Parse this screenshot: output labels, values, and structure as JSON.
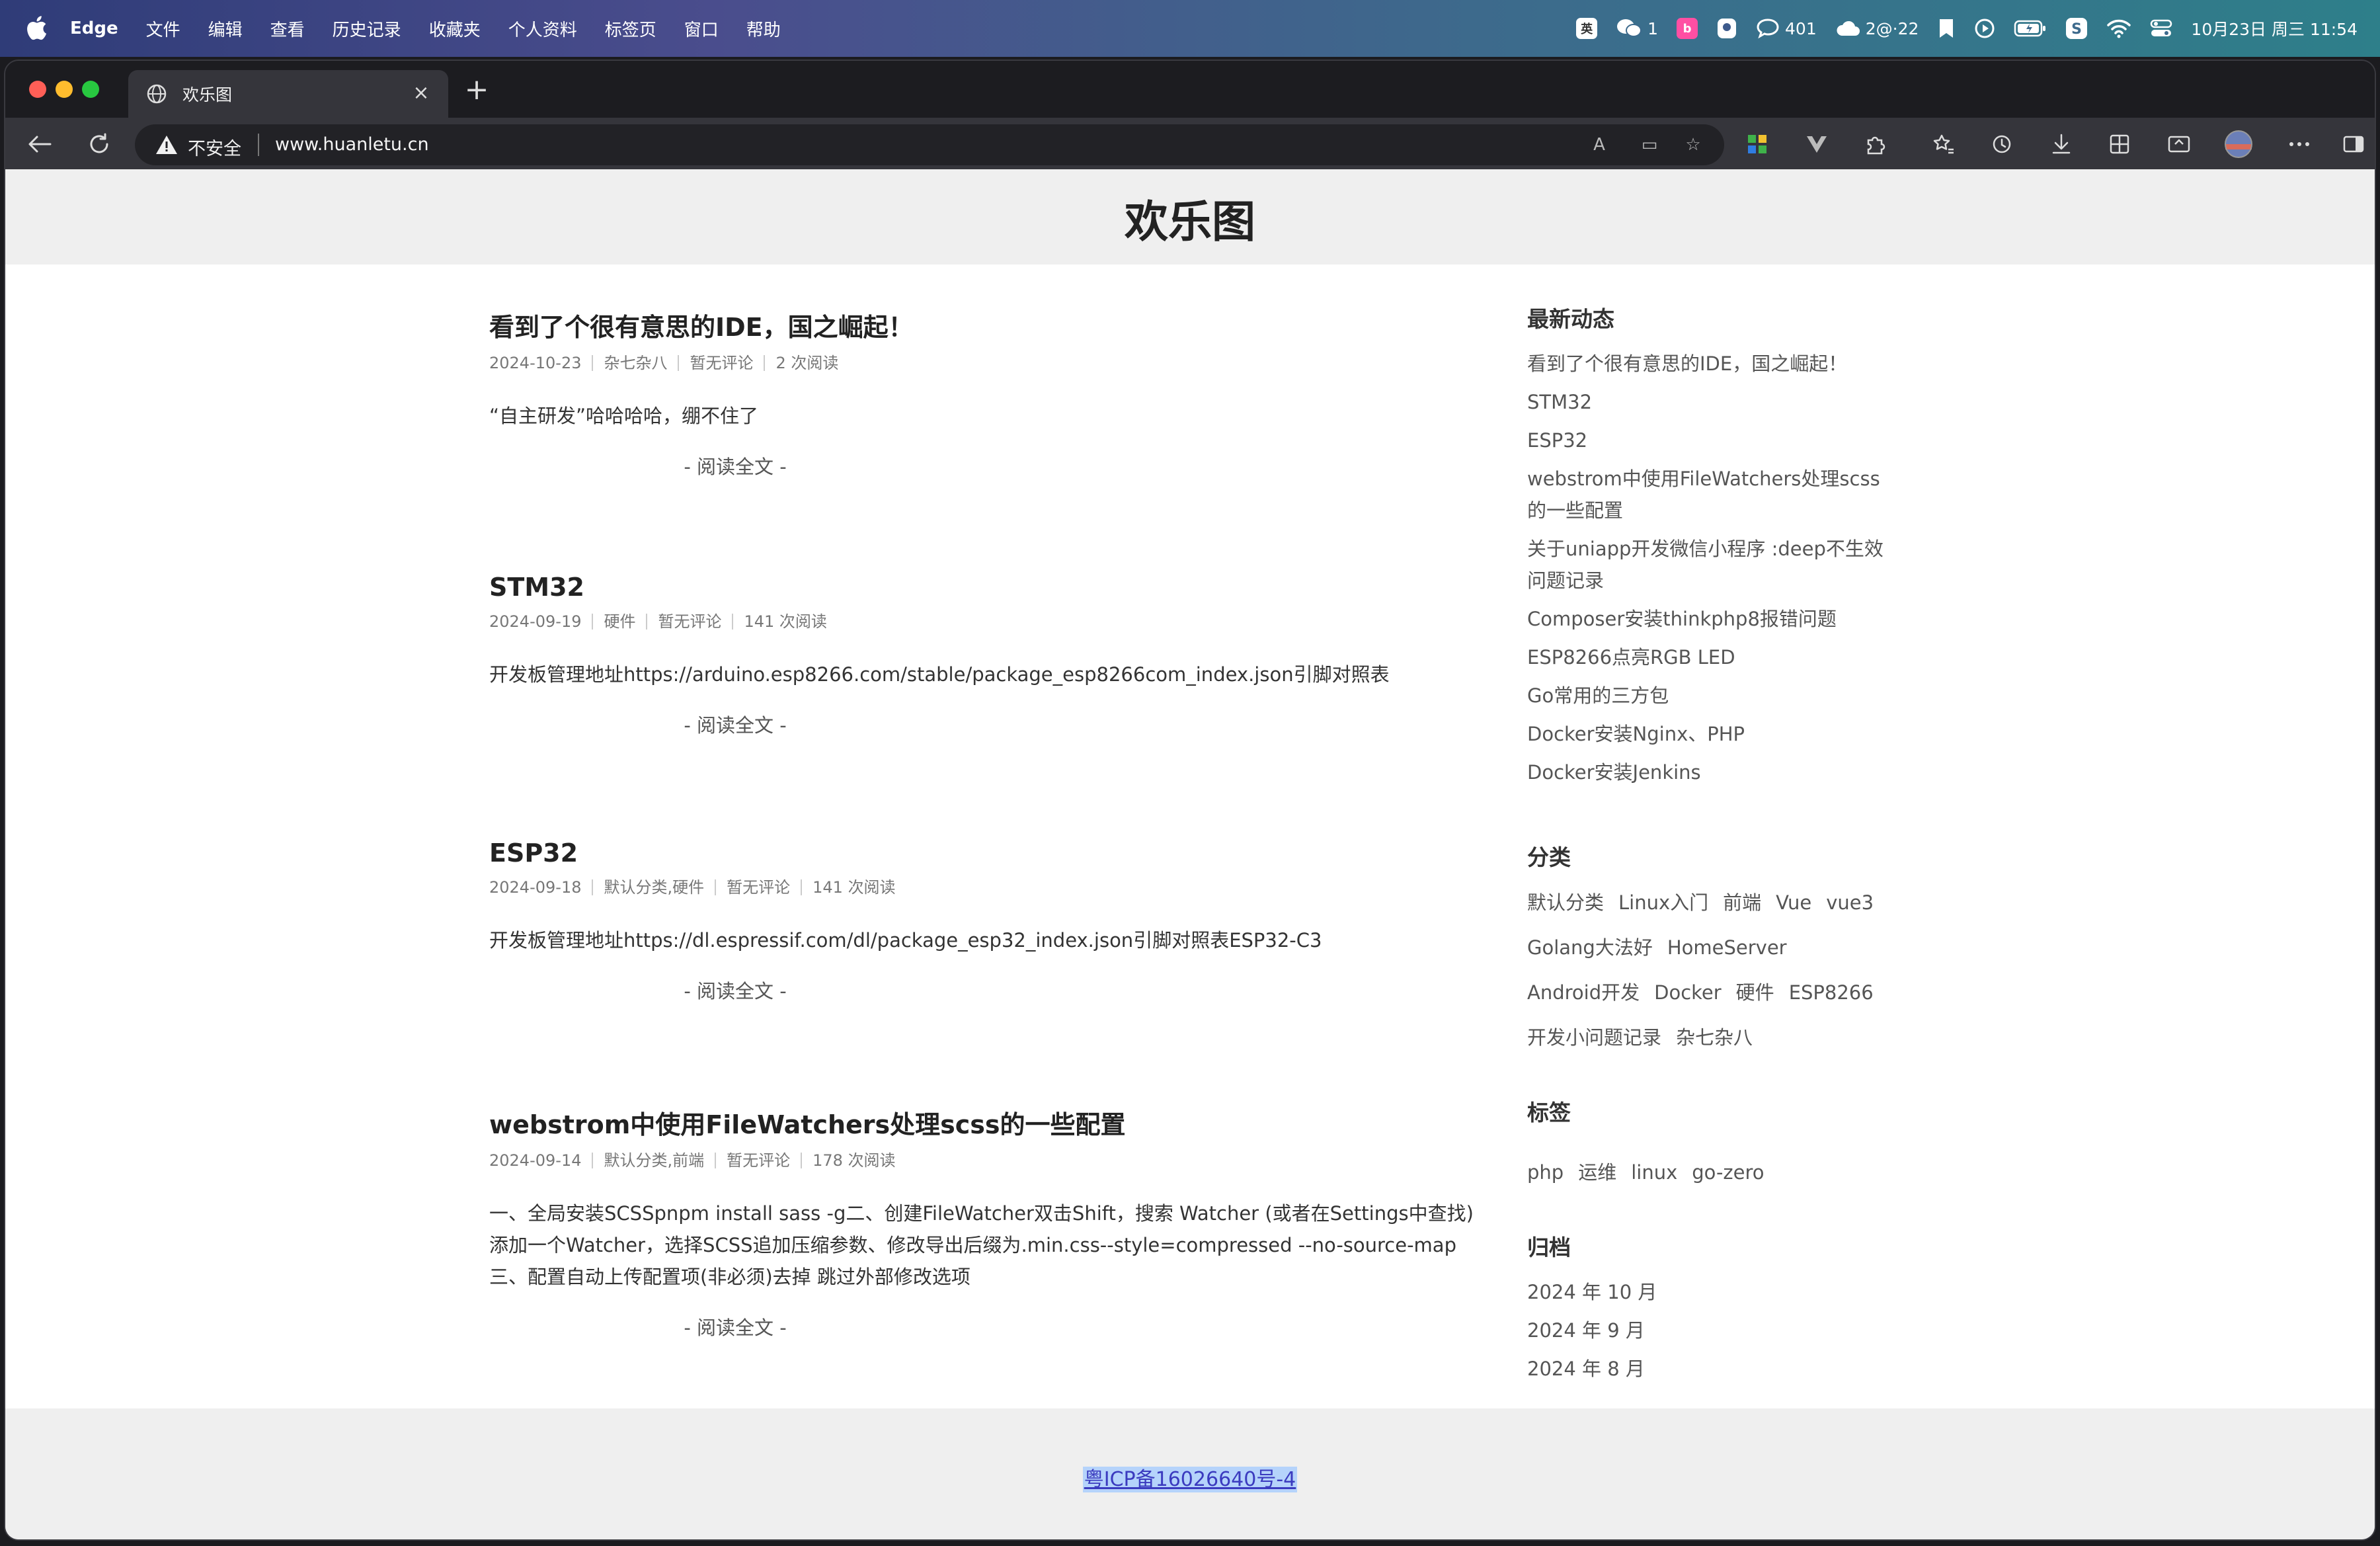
{
  "menubar": {
    "app_name": "Edge",
    "menus": [
      "文件",
      "编辑",
      "查看",
      "历史记录",
      "收藏夹",
      "个人资料",
      "标签页",
      "窗口",
      "帮助"
    ],
    "status": {
      "ime": "英",
      "wechat_count": "1",
      "pill_b": "b",
      "chat_count": "401",
      "cloud_text": "2@·22",
      "datetime": "10月23日 周三  11:54"
    }
  },
  "browser": {
    "tab_title": "欢乐图",
    "security_label": "不安全",
    "url": "www.huanletu.cn"
  },
  "site": {
    "title": "欢乐图",
    "read_more": "- 阅读全文 -",
    "posts": [
      {
        "title": "看到了个很有意思的IDE，国之崛起！",
        "date": "2024-10-23",
        "category": "杂七杂八",
        "comments": "暂无评论",
        "views": "2 次阅读",
        "excerpt": [
          "“自主研发”哈哈哈哈，绷不住了"
        ]
      },
      {
        "title": "STM32",
        "date": "2024-09-19",
        "category": "硬件",
        "comments": "暂无评论",
        "views": "141 次阅读",
        "excerpt": [
          "开发板管理地址https://arduino.esp8266.com/stable/package_esp8266com_index.json引脚对照表"
        ]
      },
      {
        "title": "ESP32",
        "date": "2024-09-18",
        "category": "默认分类,硬件",
        "comments": "暂无评论",
        "views": "141 次阅读",
        "excerpt": [
          "开发板管理地址https://dl.espressif.com/dl/package_esp32_index.json引脚对照表ESP32-C3"
        ]
      },
      {
        "title": "webstrom中使用FileWatchers处理scss的一些配置",
        "date": "2024-09-14",
        "category": "默认分类,前端",
        "comments": "暂无评论",
        "views": "178 次阅读",
        "excerpt": [
          "一、全局安装SCSSpnpm install sass -g二、创建FileWatcher双击Shift，搜索 Watcher (或者在Settings中查找)",
          "添加一个Watcher，选择SCSS追加压缩参数、修改导出后缀为.min.css--style=compressed --no-source-map",
          "三、配置自动上传配置项(非必须)去掉 跳过外部修改选项"
        ]
      }
    ],
    "sidebar": {
      "recent_heading": "最新动态",
      "recent": [
        "看到了个很有意思的IDE，国之崛起！",
        "STM32",
        "ESP32",
        "webstrom中使用FileWatchers处理scss",
        "的一些配置",
        "关于uniapp开发微信小程序 :deep不生效",
        "问题记录",
        "Composer安装thinkphp8报错问题",
        "ESP8266点亮RGB LED",
        "Go常用的三方包",
        "Docker安装Nginx、PHP",
        "Docker安装Jenkins"
      ],
      "categories_heading": "分类",
      "categories": [
        [
          "默认分类",
          "Linux入门",
          "前端",
          "Vue",
          "vue3"
        ],
        [
          "Golang大法好",
          "HomeServer"
        ],
        [
          "Android开发",
          "Docker",
          "硬件",
          "ESP8266"
        ],
        [
          "开发小问题记录",
          "杂七杂八"
        ]
      ],
      "tags_heading": "标签",
      "tags": [
        "php",
        "运维",
        "linux",
        "go-zero"
      ],
      "archive_heading": "归档",
      "archive": [
        "2024 年 10 月",
        "2024 年 9 月",
        "2024 年 8 月"
      ]
    },
    "footer_icp": "粤ICP备16026640号-4"
  }
}
